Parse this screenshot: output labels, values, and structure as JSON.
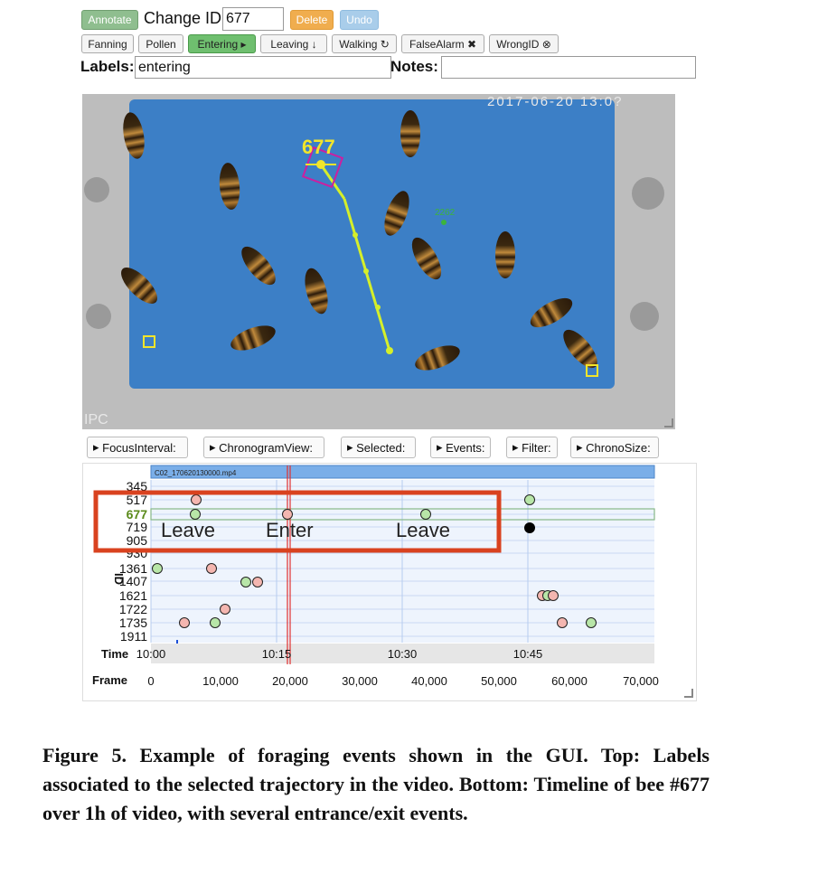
{
  "toolbar": {
    "annotate_label": "Annotate",
    "change_id_label": "Change ID",
    "id_value": "677",
    "delete_label": "Delete",
    "undo_label": "Undo"
  },
  "labels_row": [
    {
      "label": "Fanning",
      "active": false
    },
    {
      "label": "Pollen",
      "active": false
    },
    {
      "label": "Entering ▸",
      "active": true
    },
    {
      "label": "Leaving ↓",
      "active": false
    },
    {
      "label": "Walking ↻",
      "active": false
    },
    {
      "label": "FalseAlarm ✖",
      "active": false
    },
    {
      "label": "WrongID ⊗",
      "active": false
    }
  ],
  "fields": {
    "labels_caption": "Labels:",
    "labels_value": "entering",
    "notes_caption": "Notes:",
    "notes_value": ""
  },
  "video": {
    "timestamp": "2017-06-20 13:0?",
    "watermark": "IPC",
    "selected_id": "677",
    "other_id": "2262"
  },
  "panel_buttons": [
    "FocusInterval:",
    "ChronogramView:",
    "Selected:",
    "Events:",
    "Filter:",
    "ChronoSize:"
  ],
  "chronogram": {
    "file_label": "C02_170620130000.mp4",
    "id_axis_label": "ID",
    "ids": [
      "345",
      "517",
      "677",
      "719",
      "905",
      "930",
      "1361",
      "1407",
      "1621",
      "1722",
      "1735",
      "1911"
    ],
    "selected_id": "677",
    "time_label": "Time",
    "time_ticks": [
      "10:00",
      "10:15",
      "10:30",
      "10:45"
    ],
    "frame_label": "Frame",
    "frame_ticks": [
      "0",
      "10,000",
      "20,000",
      "30,000",
      "40,000",
      "50,000",
      "60,000",
      "70,000"
    ],
    "event_labels": [
      "Leave",
      "Enter",
      "Leave"
    ],
    "colors": {
      "leave": "#b8e6a8",
      "enter": "#f4b6b0",
      "highlight_box": "#d9421f",
      "cursor": "#e03030",
      "file_bar": "#7aaee8"
    }
  },
  "caption": {
    "text": "Figure 5. Example of foraging events shown in the GUI. Top: Labels associated to the selected trajectory in the video. Bottom: Timeline of bee #677 over 1h of video, with several entrance/exit events."
  }
}
